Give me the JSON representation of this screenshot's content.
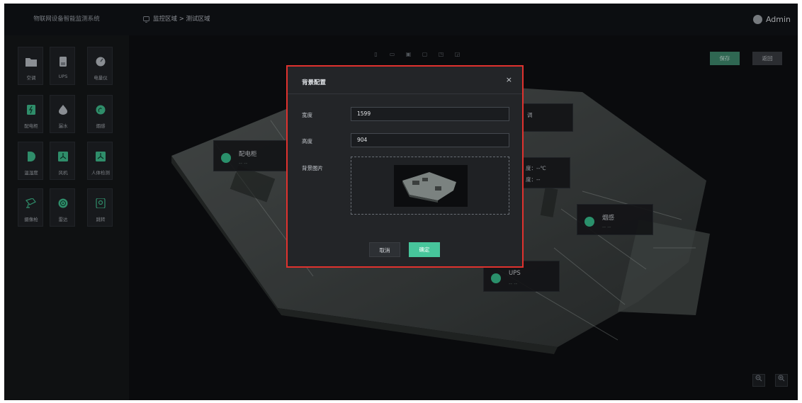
{
  "app": {
    "title": "物联网设备智能监测系统"
  },
  "breadcrumb": {
    "path": "监控区域 > 测试区域"
  },
  "user": {
    "name": "Admin"
  },
  "sidebar": {
    "devices": [
      {
        "label": "空调",
        "icon": "folder-icon"
      },
      {
        "label": "UPS",
        "icon": "battery-icon"
      },
      {
        "label": "电量仪",
        "icon": "meter-icon"
      },
      {
        "label": "配电柜",
        "icon": "cabinet-icon"
      },
      {
        "label": "漏水",
        "icon": "water-drop-icon"
      },
      {
        "label": "烟感",
        "icon": "smoke-icon"
      },
      {
        "label": "温湿度",
        "icon": "thermo-icon"
      },
      {
        "label": "风机",
        "icon": "fan-icon"
      },
      {
        "label": "人体检测",
        "icon": "body-sensor-icon"
      },
      {
        "label": "摄像枪",
        "icon": "camera-icon"
      },
      {
        "label": "雷达",
        "icon": "radar-icon"
      },
      {
        "label": "跳转",
        "icon": "jump-icon"
      }
    ]
  },
  "actions": {
    "save": "保存",
    "back": "返回"
  },
  "cards": {
    "cabinet": {
      "name": "配电柜",
      "value": "-- --"
    },
    "ac": {
      "name": "调"
    },
    "temp": {
      "line1": "度：--℃",
      "line2": "度：--"
    },
    "smoke": {
      "name": "烟感",
      "value": "-- --"
    },
    "ups": {
      "name": "UPS",
      "value": "-- --"
    }
  },
  "modal": {
    "title": "背景配置",
    "close": "×",
    "width_label": "宽度",
    "width_value": "1599",
    "height_label": "高度",
    "height_value": "904",
    "image_label": "背景图片",
    "cancel": "取消",
    "confirm": "确定"
  },
  "colors": {
    "accent": "#47c59b",
    "highlight_border": "#e0322e"
  }
}
